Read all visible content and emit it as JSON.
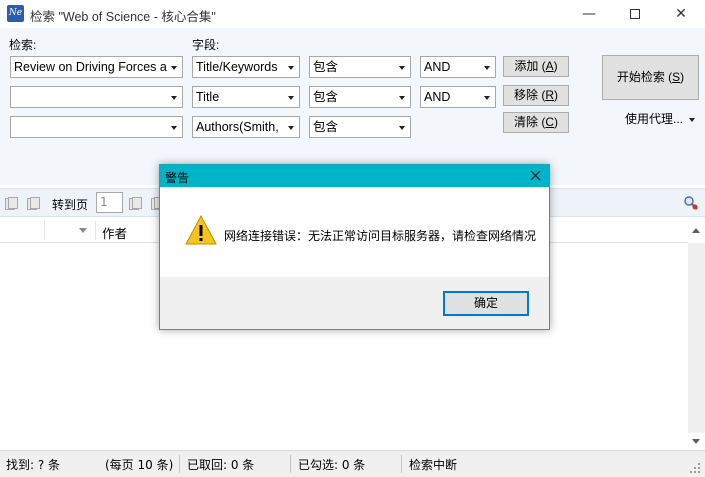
{
  "window": {
    "title": "检索 \"Web of Science - 核心合集\"",
    "icon_text": "Ne",
    "minimize_glyph": "—",
    "close_glyph": "✕"
  },
  "search": {
    "query_label": "检索:",
    "field_label": "字段:",
    "rows": [
      {
        "query": "Review on Driving Forces a",
        "field": "Title/Keywords",
        "match": "包含",
        "operator": "AND"
      },
      {
        "query": "",
        "field": "Title",
        "match": "包含",
        "operator": "AND"
      },
      {
        "query": "",
        "field": "Authors(Smith,",
        "match": "包含"
      }
    ],
    "add_button": {
      "text": "添加 (",
      "key": "A",
      "end": ")"
    },
    "remove_button": {
      "text": "移除 (",
      "key": "R",
      "end": ")"
    },
    "clear_button": {
      "text": "清除 (",
      "key": "C",
      "end": ")"
    },
    "start_button": {
      "text": "开始检索 (",
      "key": "S",
      "end": ")"
    },
    "proxy_link": "使用代理..."
  },
  "toolbar": {
    "goto_label": "转到页",
    "page_value": "1"
  },
  "table": {
    "columns": [
      "作者"
    ]
  },
  "statusbar": {
    "found": "找到: ? 条",
    "per_page": "(每页 10 条)",
    "retrieved": "已取回: 0 条",
    "checked": "已勾选: 0 条",
    "status": "检索中断"
  },
  "dialog": {
    "title": "警告",
    "message": "网络连接错误：无法正常访问目标服务器，请检查网络情况",
    "ok_button": "确定",
    "icon": "warning-icon",
    "title_color": "#00b4c8"
  }
}
